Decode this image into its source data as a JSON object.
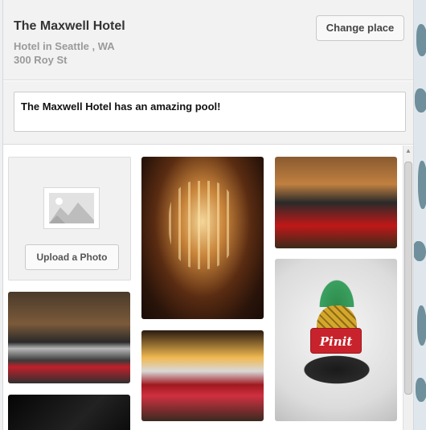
{
  "place": {
    "name": "The Maxwell Hotel",
    "type": "Hotel in Seattle , WA",
    "address": "300 Roy St",
    "change_label": "Change place"
  },
  "description": {
    "text": "The Maxwell Hotel has an amazing pool!"
  },
  "photos": {
    "upload_label": "Upload a Photo",
    "pinit_label": "Pinit",
    "upload_icon": "image-placeholder-icon",
    "items": [
      {
        "name": "hotel-room-bed-photo"
      },
      {
        "name": "dark-photo"
      },
      {
        "name": "chandelier-photo"
      },
      {
        "name": "hotel-bed-photo"
      },
      {
        "name": "hotel-room-red-bed-photo"
      },
      {
        "name": "pineapple-tile-photo"
      }
    ]
  },
  "colors": {
    "pinit_red": "#c8232c",
    "header_bg": "#f2f2f2"
  }
}
